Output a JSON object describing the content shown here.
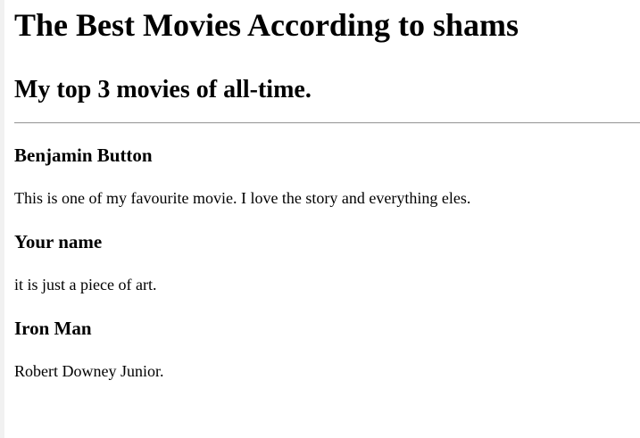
{
  "header": {
    "title": "The Best Movies According to shams",
    "subtitle": "My top 3 movies of all-time."
  },
  "movies": [
    {
      "title": "Benjamin Button",
      "description": "This is one of my favourite movie. I love the story and everything eles."
    },
    {
      "title": "Your name",
      "description": "it is just a piece of art."
    },
    {
      "title": "Iron Man",
      "description": "Robert Downey Junior."
    }
  ]
}
